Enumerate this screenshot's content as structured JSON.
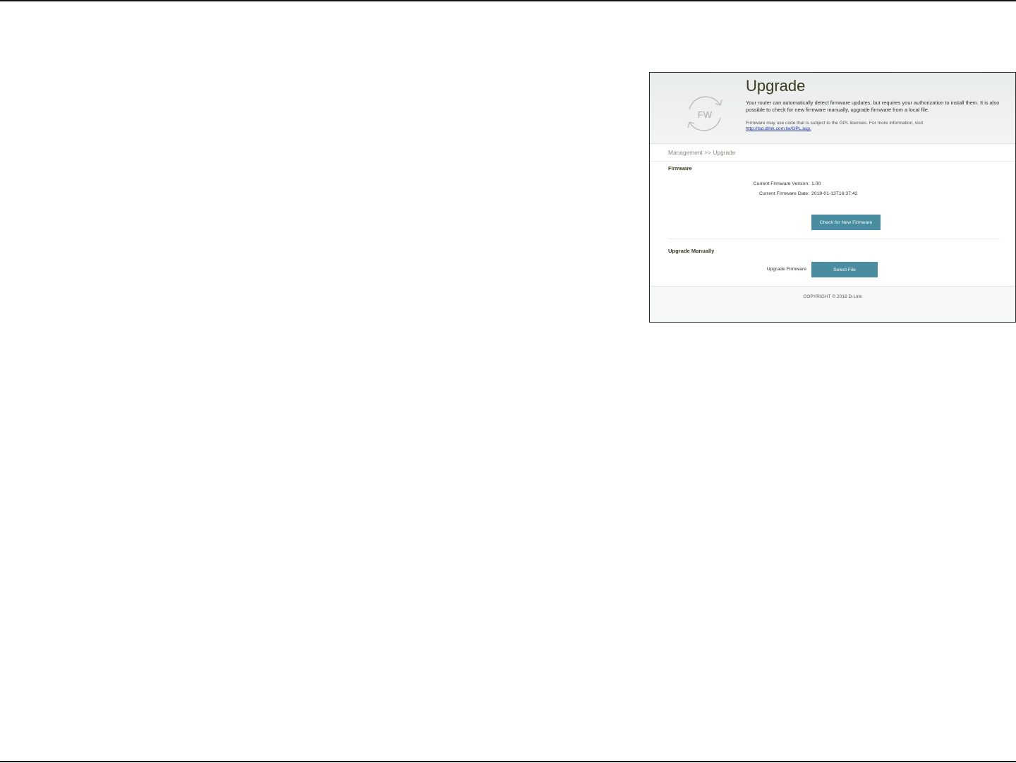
{
  "hero": {
    "logo_text": "FW",
    "title": "Upgrade",
    "description": "Your router can automatically detect firmware updates, but requires your authorization to install them. It is also possible to check for new firmware manually, upgrade firmware from a local file.",
    "gpl_notice": "Firmware may use code that is subject to the GPL licenses. For more information, visit",
    "gpl_link": "http://tsd.dlink.com.tw/GPL.asp."
  },
  "breadcrumb": "Management >> Upgrade",
  "firmware": {
    "section_title": "Firmware",
    "version_label": "Current Firmware Version:",
    "version_value": "1.00",
    "date_label": "Current Firmware Date:",
    "date_value": "2018-01-13T16:37:42",
    "check_button": "Check for New Firmware"
  },
  "upgrade_manually": {
    "section_title": "Upgrade Manually",
    "upgrade_label": "Upgrade Firmware",
    "select_button": "Select File"
  },
  "footer": {
    "copyright": "COPYRIGHT © 2016 D-Link"
  },
  "colors": {
    "button": "#4a8da0",
    "title": "#3b3b1f",
    "link": "#1a2fa8"
  },
  "icons": {
    "logo": "fw-circular-arrows-icon"
  }
}
